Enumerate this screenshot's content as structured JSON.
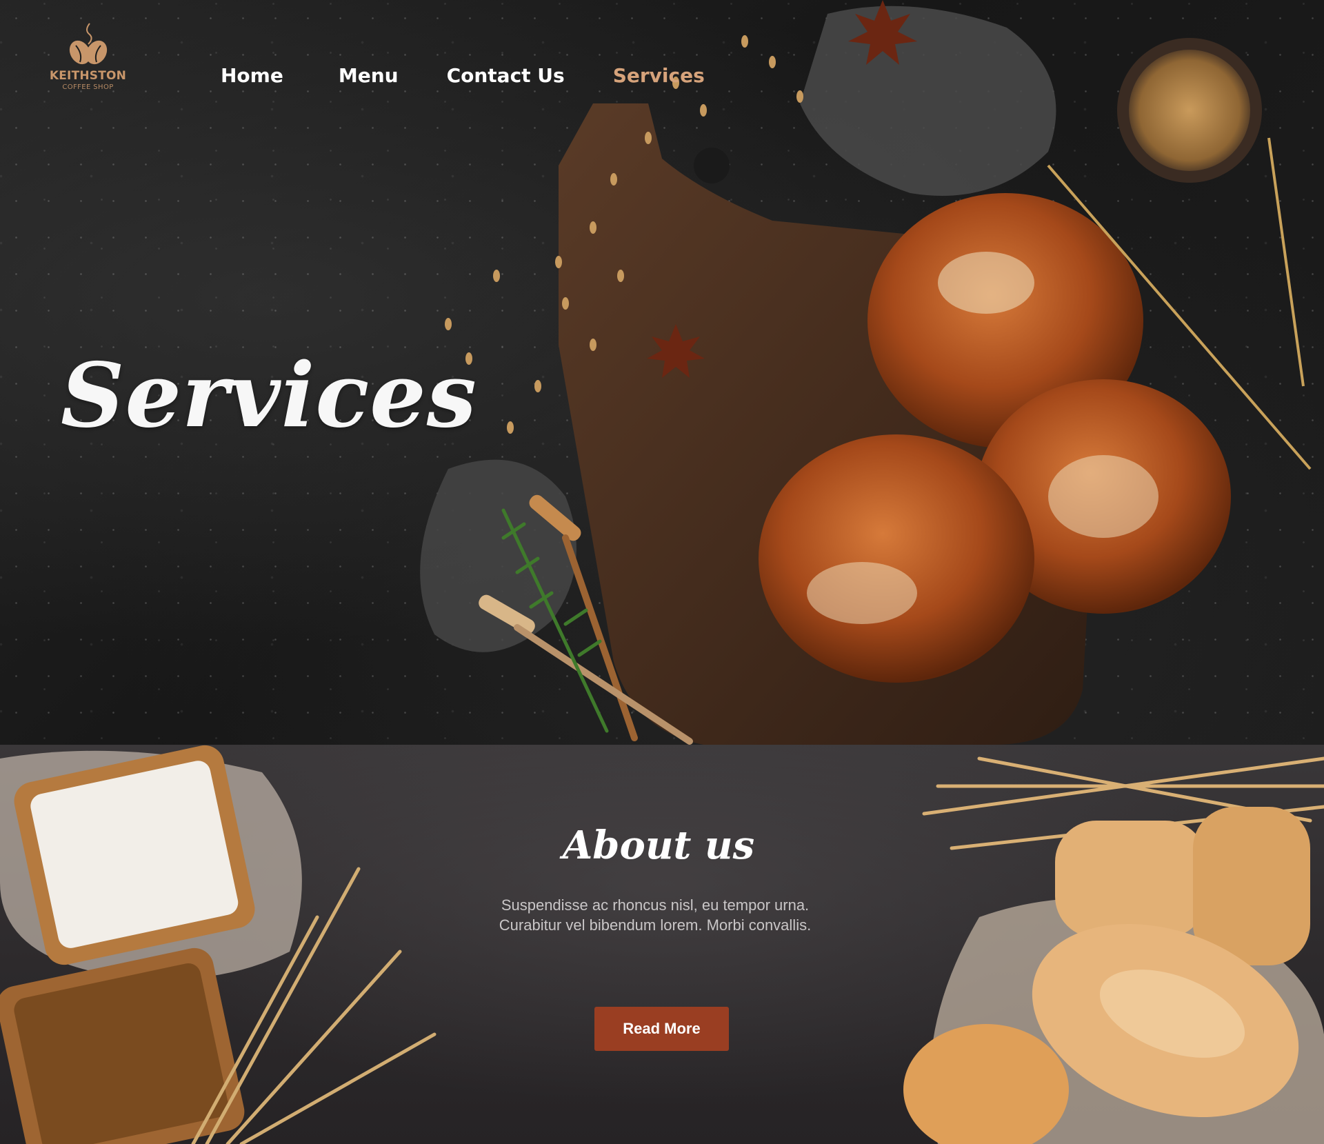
{
  "brand": {
    "name": "KEITHSTON",
    "tagline": "COFFEE SHOP",
    "accent_color": "#d6a37b"
  },
  "nav": {
    "items": [
      {
        "label": "Home",
        "active": false
      },
      {
        "label": "Menu",
        "active": false
      },
      {
        "label": "Contact Us",
        "active": false
      },
      {
        "label": "Services",
        "active": true
      }
    ]
  },
  "hero": {
    "title": "Services",
    "image": "bread-buns-on-wooden-board"
  },
  "about": {
    "heading": "About us",
    "body": "Suspendisse ac rhoncus nisl, eu tempor urna. Curabitur vel bibendum lorem. Morbi convallis.",
    "button_label": "Read More",
    "button_color": "#9a3e22"
  }
}
